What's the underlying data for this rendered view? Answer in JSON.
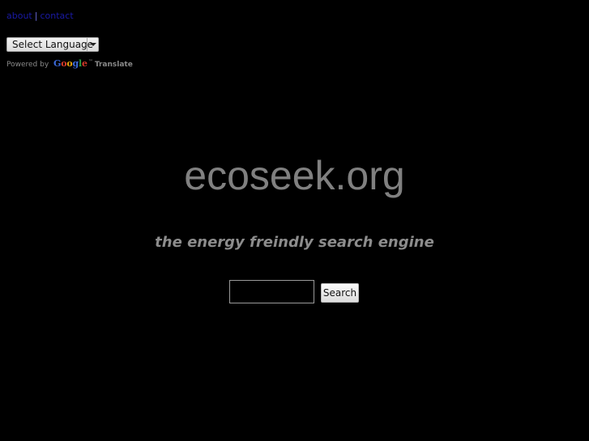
{
  "top_nav": {
    "about_label": "about",
    "separator": "|",
    "contact_label": "contact"
  },
  "translate_widget": {
    "select_label": "Select Language",
    "powered_by": "Powered by",
    "google_letters": [
      "G",
      "o",
      "o",
      "g",
      "l",
      "e"
    ],
    "trademark": "™",
    "translate_label": "Translate"
  },
  "main": {
    "title": "ecoseek.org",
    "tagline": "the energy freindly search engine"
  },
  "search": {
    "input_value": "",
    "button_label": "Search"
  },
  "colors": {
    "background": "#000000",
    "link": "#1a1aa6",
    "title_text": "#808080",
    "tagline_text": "#8c8c8c"
  }
}
